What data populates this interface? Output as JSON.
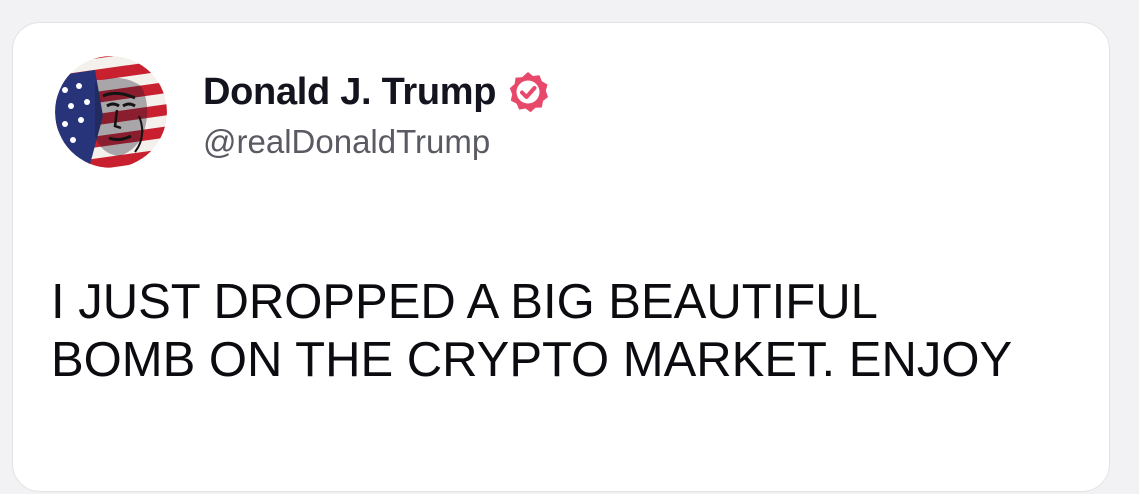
{
  "post": {
    "author": {
      "display_name": "Donald J. Trump",
      "handle": "@realDonaldTrump",
      "verified_icon": "verified-badge-icon",
      "avatar": "flag-portrait-avatar"
    },
    "text_lines": [
      "I JUST DROPPED A BIG BEAUTIFUL",
      "BOMB ON THE CRYPTO MARKET. ENJOY"
    ]
  },
  "colors": {
    "card_background": "#ffffff",
    "page_background": "#f2f2f4",
    "verified_badge": "#e8496b",
    "name_text": "#14141f",
    "handle_text": "#5a5a62"
  }
}
